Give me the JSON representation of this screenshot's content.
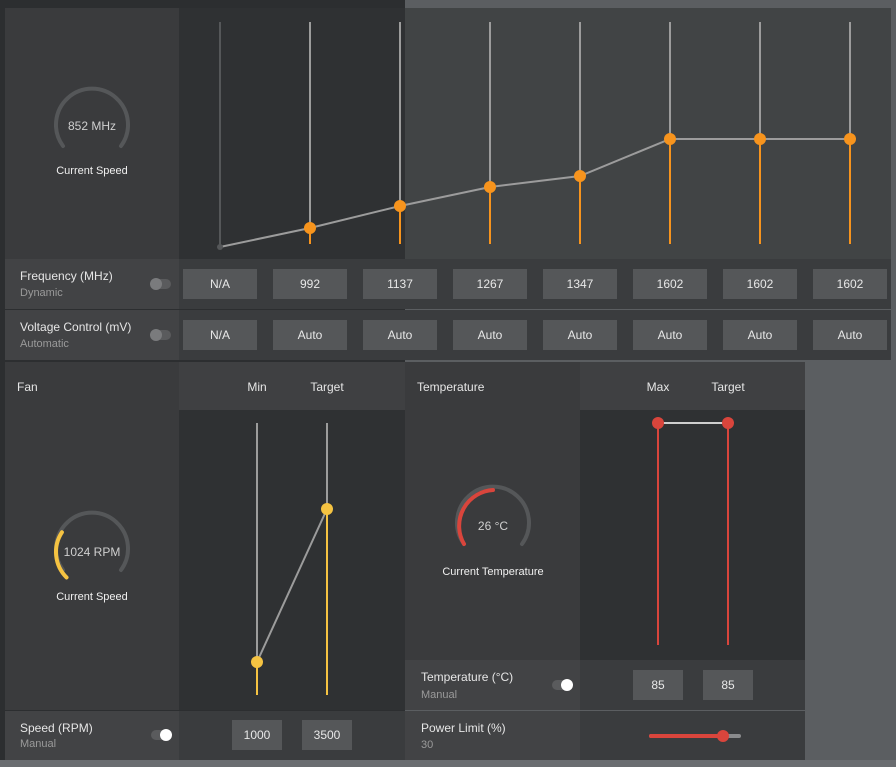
{
  "gpu": {
    "gauge_value": "852 MHz",
    "gauge_caption": "Current Speed",
    "frequency": {
      "label": "Frequency (MHz)",
      "mode": "Dynamic",
      "states": [
        "N/A",
        "992",
        "1137",
        "1267",
        "1347",
        "1602",
        "1602",
        "1602"
      ]
    },
    "voltage": {
      "label": "Voltage Control (mV)",
      "mode": "Automatic",
      "states": [
        "N/A",
        "Auto",
        "Auto",
        "Auto",
        "Auto",
        "Auto",
        "Auto",
        "Auto"
      ]
    }
  },
  "fan": {
    "title": "Fan",
    "col_min": "Min",
    "col_target": "Target",
    "gauge_value": "1024 RPM",
    "gauge_caption": "Current Speed",
    "gauge_fraction": 0.29,
    "speed_label": "Speed (RPM)",
    "speed_mode": "Manual",
    "min_value": "1000",
    "target_value": "3500"
  },
  "temperature": {
    "title": "Temperature",
    "col_max": "Max",
    "col_target": "Target",
    "gauge_value": "26 °C",
    "gauge_caption": "Current Temperature",
    "temp_label": "Temperature (°C)",
    "temp_mode": "Manual",
    "max_value": "85",
    "target_value": "85",
    "power_label": "Power Limit (%)",
    "power_value": "30",
    "power_fraction": 0.8
  },
  "colors": {
    "orange": "#f7941d",
    "yellow": "#f5c342",
    "red": "#d9453c"
  }
}
